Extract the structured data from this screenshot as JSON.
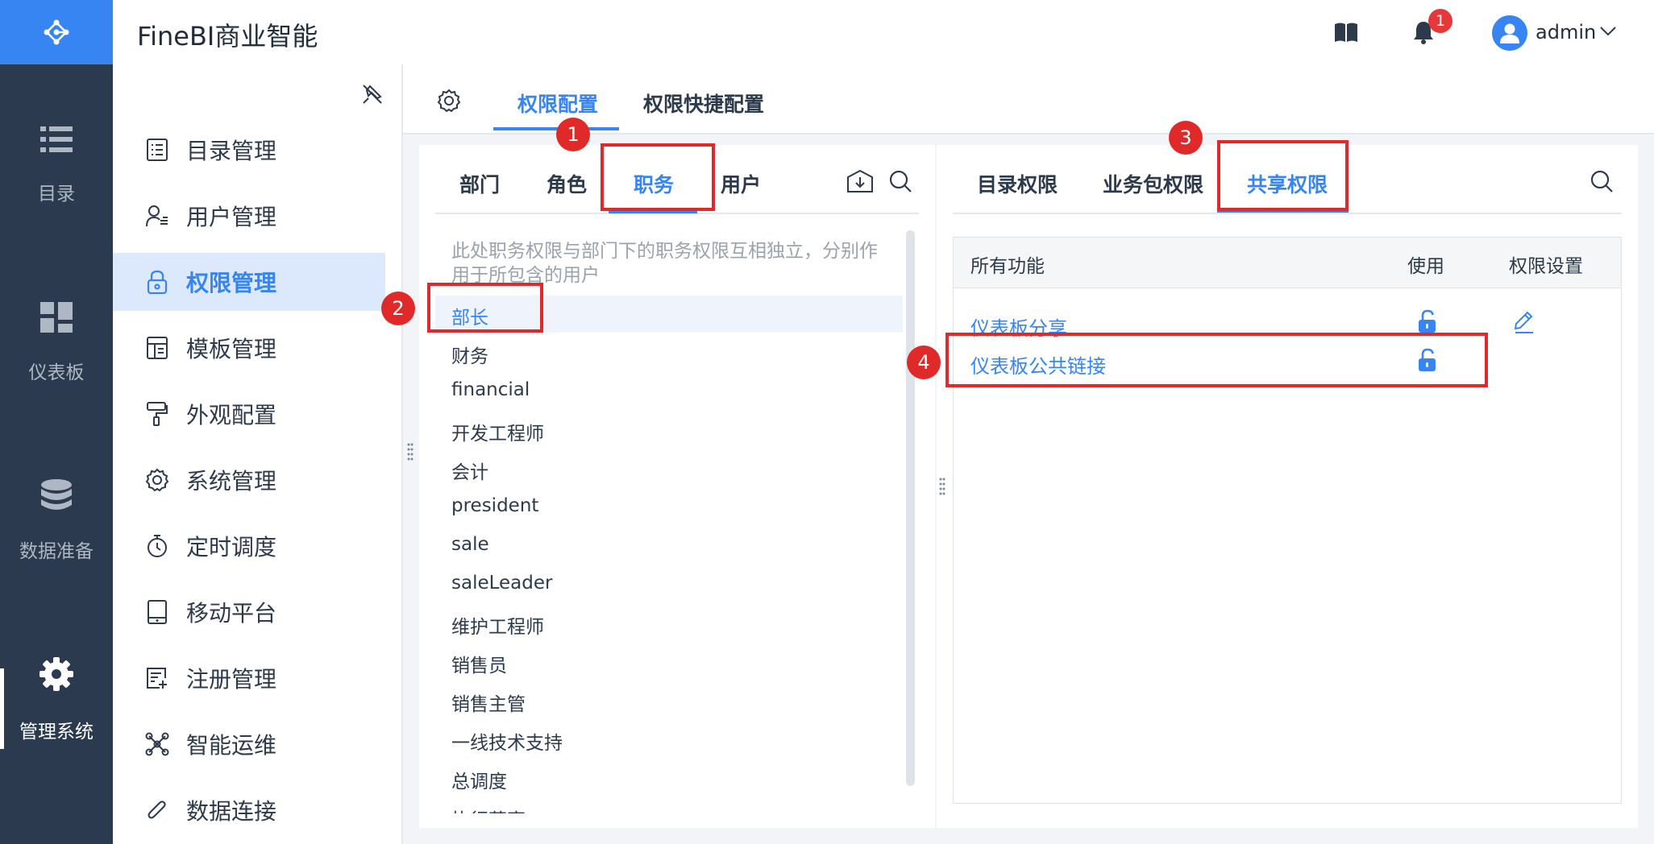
{
  "app": {
    "title": "FineBI商业智能"
  },
  "header": {
    "notification_count": "1",
    "user_name": "admin"
  },
  "nav": {
    "items": [
      {
        "label": "目录",
        "icon": "list-icon"
      },
      {
        "label": "仪表板",
        "icon": "dashboard-icon"
      },
      {
        "label": "数据准备",
        "icon": "database-icon"
      },
      {
        "label": "管理系统",
        "icon": "gear-icon",
        "active": true
      }
    ]
  },
  "menu": {
    "items": [
      {
        "label": "目录管理",
        "icon": "directory-icon"
      },
      {
        "label": "用户管理",
        "icon": "user-manage-icon"
      },
      {
        "label": "权限管理",
        "icon": "lock-icon",
        "active": true
      },
      {
        "label": "模板管理",
        "icon": "template-icon"
      },
      {
        "label": "外观配置",
        "icon": "paint-roller-icon"
      },
      {
        "label": "系统管理",
        "icon": "gear-icon"
      },
      {
        "label": "定时调度",
        "icon": "timer-icon"
      },
      {
        "label": "移动平台",
        "icon": "tablet-icon"
      },
      {
        "label": "注册管理",
        "icon": "register-icon"
      },
      {
        "label": "智能运维",
        "icon": "network-icon"
      },
      {
        "label": "数据连接",
        "icon": "paperclip-icon"
      }
    ]
  },
  "tabs": {
    "permission_config": "权限配置",
    "quick_config": "权限快捷配置"
  },
  "left_panel": {
    "tabs": [
      "部门",
      "角色",
      "职务",
      "用户"
    ],
    "active_tab": "职务",
    "note": "此处职务权限与部门下的职务权限互相独立，分别作用于所包含的用户",
    "positions": [
      "部长",
      "财务",
      "financial",
      "开发工程师",
      "会计",
      "president",
      "sale",
      "saleLeader",
      "维护工程师",
      "销售员",
      "销售主管",
      "一线技术支持",
      "总调度",
      "执行董事"
    ],
    "selected": "部长"
  },
  "right_panel": {
    "tabs": [
      "目录权限",
      "业务包权限",
      "共享权限"
    ],
    "active_tab": "共享权限",
    "columns": [
      "所有功能",
      "使用",
      "权限设置"
    ],
    "rows": [
      {
        "name": "仪表板分享",
        "use": "unlocked"
      },
      {
        "name": "仪表板公共链接",
        "use": "unlocked"
      }
    ]
  },
  "annotations": [
    "1",
    "2",
    "3",
    "4"
  ],
  "colors": {
    "accent": "#3685f2",
    "nav_bg": "#2b3a4f",
    "annotation": "#e02a2a"
  }
}
